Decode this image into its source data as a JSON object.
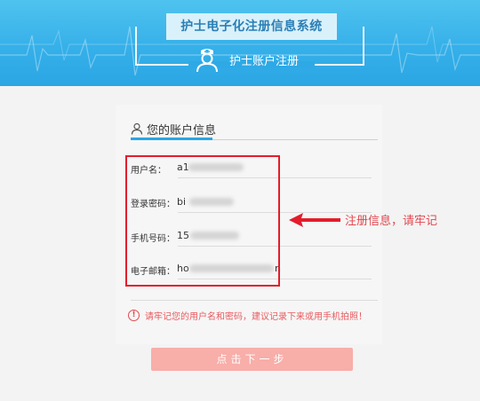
{
  "header": {
    "title": "护士电子化注册信息系统",
    "subtitle": "护士账户注册",
    "icon": "nurse-icon"
  },
  "section": {
    "title": "您的账户信息",
    "icon": "user-icon"
  },
  "fields": [
    {
      "label": "用户名：",
      "value": "a1"
    },
    {
      "label": "登录密码：",
      "value": "bi"
    },
    {
      "label": "手机号码：",
      "value": "15"
    },
    {
      "label": "电子邮箱：",
      "value": "ho",
      "suffix": "n"
    }
  ],
  "annotation": {
    "text": "注册信息，请牢记",
    "arrow_icon": "left-arrow-icon"
  },
  "warning": {
    "icon": "exclamation-circle-icon",
    "symbol": "!",
    "text": "请牢记您的用户名和密码，建议记录下来或用手机拍照！"
  },
  "next_button": {
    "label": "点击下一步"
  },
  "colors": {
    "header_blue": "#36b0e9",
    "accent_blue": "#2aa6e4",
    "annotation_red": "#e31d2b",
    "button_pink": "#f8aea9",
    "warning_red": "#e85a5f"
  }
}
